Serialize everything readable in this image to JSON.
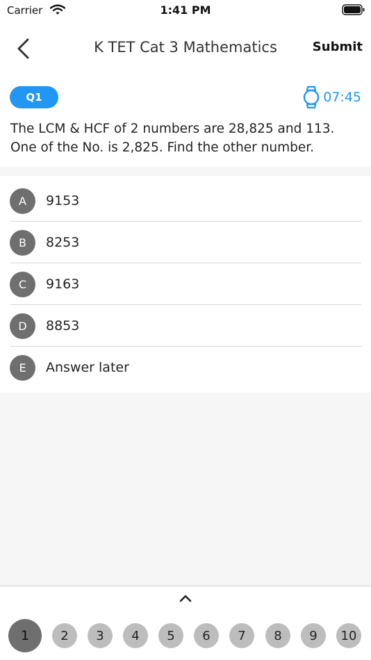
{
  "status_bar": {
    "carrier": "Carrier",
    "time": "1:41 PM"
  },
  "nav": {
    "title": "K TET Cat 3 Mathematics",
    "submit_label": "Submit"
  },
  "question": {
    "badge": "Q1",
    "timer": "07:45",
    "text": "The LCM & HCF of 2 numbers are 28,825 and 113. One of the No. is 2,825. Find the other number."
  },
  "options": [
    {
      "letter": "A",
      "text": "9153"
    },
    {
      "letter": "B",
      "text": "8253"
    },
    {
      "letter": "C",
      "text": "9163"
    },
    {
      "letter": "D",
      "text": "8853"
    },
    {
      "letter": "E",
      "text": "Answer later"
    }
  ],
  "pager": {
    "pages": [
      "1",
      "2",
      "3",
      "4",
      "5",
      "6",
      "7",
      "8",
      "9",
      "10"
    ],
    "active_index": 0
  },
  "colors": {
    "accent": "#2196f3",
    "option_circle": "#6f6f6f",
    "page_dot": "#bdbdbd"
  }
}
